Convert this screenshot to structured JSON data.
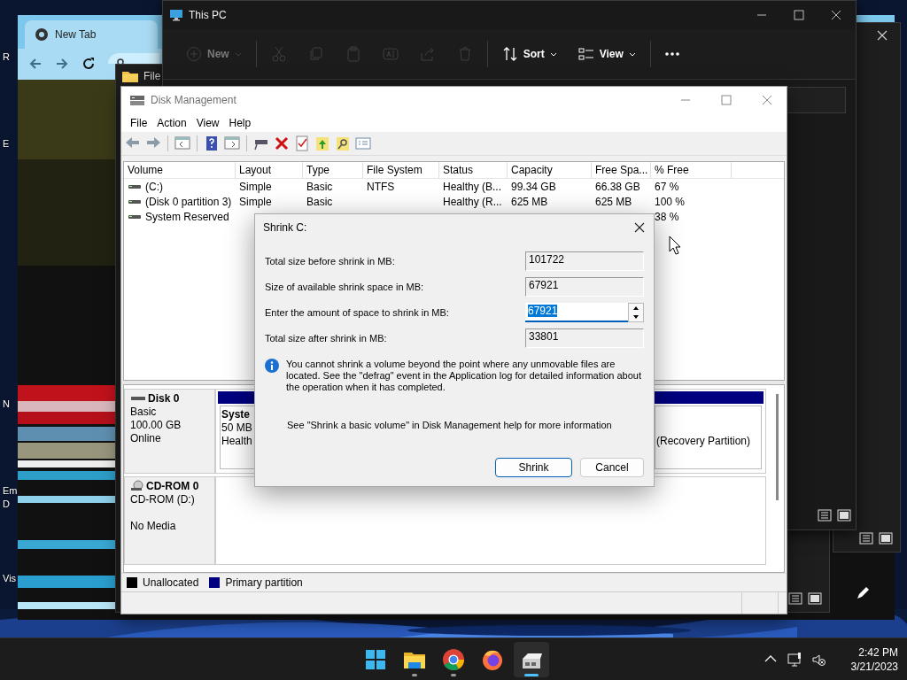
{
  "desktop": {
    "icon_labels": [
      "R",
      "E",
      "N",
      "Em",
      "D",
      "Vis"
    ]
  },
  "browser": {
    "tab_title": "New Tab"
  },
  "explorer_behind": {
    "title": "File"
  },
  "explorer": {
    "title": "This PC",
    "toolbar": [
      {
        "kind": "new",
        "label": "New",
        "disabled": true
      },
      {
        "kind": "cut",
        "disabled": true
      },
      {
        "kind": "copy",
        "disabled": true
      },
      {
        "kind": "paste",
        "disabled": true
      },
      {
        "kind": "rename",
        "disabled": true
      },
      {
        "kind": "share",
        "disabled": true
      },
      {
        "kind": "delete",
        "disabled": true
      },
      {
        "kind": "sort",
        "label": "Sort",
        "disabled": false
      },
      {
        "kind": "view",
        "label": "View",
        "disabled": false
      },
      {
        "kind": "more",
        "disabled": false
      }
    ]
  },
  "disk_management": {
    "title": "Disk Management",
    "menu": [
      "File",
      "Action",
      "View",
      "Help"
    ],
    "toolbar": [
      {
        "kind": "back"
      },
      {
        "kind": "forward"
      },
      {
        "kind": "console-tree"
      },
      {
        "kind": "help"
      },
      {
        "kind": "action-pane"
      },
      {
        "kind": "connect"
      },
      {
        "kind": "delete"
      },
      {
        "kind": "check"
      },
      {
        "kind": "up"
      },
      {
        "kind": "search"
      },
      {
        "kind": "properties"
      }
    ],
    "volumes": {
      "columns": [
        "Volume",
        "Layout",
        "Type",
        "File System",
        "Status",
        "Capacity",
        "Free Spa...",
        "% Free"
      ],
      "rows": [
        {
          "volume": "(C:)",
          "layout": "Simple",
          "type": "Basic",
          "file_system": "NTFS",
          "status": "Healthy (B...",
          "capacity": "99.34 GB",
          "free_space": "66.38 GB",
          "percent_free": "67 %"
        },
        {
          "volume": "(Disk 0 partition 3)",
          "layout": "Simple",
          "type": "Basic",
          "status": "Healthy (R...",
          "capacity": "625 MB",
          "free_space": "625 MB",
          "percent_free": "100 %"
        },
        {
          "volume": "System Reserved",
          "percent_free": "38 %"
        }
      ]
    },
    "disks": [
      {
        "kind": "disk",
        "name": "Disk 0",
        "type": "Basic",
        "size": "100.00 GB",
        "status": "Online",
        "partitions": [
          {
            "name": "Syste",
            "size": "50 MB",
            "status": "Health"
          },
          {
            "status": "(Recovery Partition)"
          }
        ]
      },
      {
        "kind": "cdrom",
        "name": "CD-ROM 0",
        "type": "CD-ROM (D:)",
        "status": "No Media"
      }
    ],
    "legend": [
      {
        "label": "Unallocated",
        "color": "#000000"
      },
      {
        "label": "Primary partition",
        "color": "#000080"
      }
    ]
  },
  "shrink_dialog": {
    "title": "Shrink C:",
    "fields": [
      {
        "kind": "readonly",
        "label": "Total size before shrink in MB:",
        "value": "101722"
      },
      {
        "kind": "readonly",
        "label": "Size of available shrink space in MB:",
        "value": "67921"
      },
      {
        "kind": "spin",
        "label": "Enter the amount of space to shrink in MB:",
        "value": "67921"
      },
      {
        "kind": "readonly",
        "label": "Total size after shrink in MB:",
        "value": "33801"
      }
    ],
    "info": "You cannot shrink a volume beyond the point where any unmovable files are located. See the \"defrag\" event in the Application log for detailed information about the operation when it has completed.",
    "help": "See \"Shrink a basic volume\" in Disk Management help for more information",
    "buttons": [
      {
        "label": "Shrink",
        "default": true
      },
      {
        "label": "Cancel",
        "default": false
      }
    ]
  },
  "taskbar": {
    "apps": [
      {
        "kind": "start",
        "running": false,
        "active": false
      },
      {
        "kind": "explorer",
        "running": true,
        "active": false
      },
      {
        "kind": "chrome",
        "running": true,
        "active": false
      },
      {
        "kind": "firefox",
        "running": false,
        "active": false
      },
      {
        "kind": "disk-management",
        "running": true,
        "active": true
      }
    ],
    "tray": [
      {
        "kind": "chevron"
      },
      {
        "kind": "network"
      },
      {
        "kind": "speaker-muted"
      }
    ],
    "time": "2:42 PM",
    "date": "3/21/2023"
  }
}
